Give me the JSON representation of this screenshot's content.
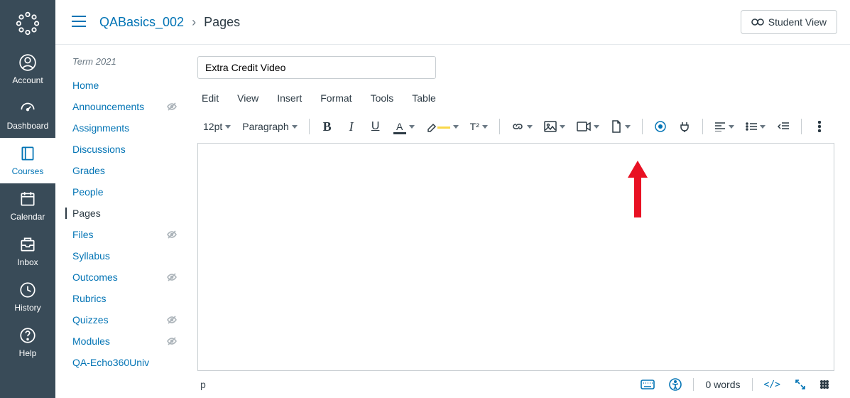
{
  "globalNav": {
    "items": [
      {
        "label": "Account",
        "icon": "user-circle-icon"
      },
      {
        "label": "Dashboard",
        "icon": "dashboard-icon"
      },
      {
        "label": "Courses",
        "icon": "book-icon"
      },
      {
        "label": "Calendar",
        "icon": "calendar-icon"
      },
      {
        "label": "Inbox",
        "icon": "inbox-icon"
      },
      {
        "label": "History",
        "icon": "clock-icon"
      },
      {
        "label": "Help",
        "icon": "help-icon"
      }
    ],
    "active_index": 2
  },
  "breadcrumb": {
    "course": "QABasics_002",
    "current": "Pages"
  },
  "top_buttons": {
    "student_view": "Student View"
  },
  "courseNav": {
    "term": "Term 2021",
    "items": [
      {
        "label": "Home",
        "hidden": false
      },
      {
        "label": "Announcements",
        "hidden": true
      },
      {
        "label": "Assignments",
        "hidden": false
      },
      {
        "label": "Discussions",
        "hidden": false
      },
      {
        "label": "Grades",
        "hidden": false
      },
      {
        "label": "People",
        "hidden": false
      },
      {
        "label": "Pages",
        "hidden": false,
        "active": true
      },
      {
        "label": "Files",
        "hidden": true
      },
      {
        "label": "Syllabus",
        "hidden": false
      },
      {
        "label": "Outcomes",
        "hidden": true
      },
      {
        "label": "Rubrics",
        "hidden": false
      },
      {
        "label": "Quizzes",
        "hidden": true
      },
      {
        "label": "Modules",
        "hidden": true
      },
      {
        "label": "QA-Echo360Univ",
        "hidden": false
      }
    ]
  },
  "editor": {
    "title_value": "Extra Credit Video",
    "menus": [
      "Edit",
      "View",
      "Insert",
      "Format",
      "Tools",
      "Table"
    ],
    "font_size": "12pt",
    "block_format": "Paragraph",
    "superscript_label": "T²",
    "status_path": "p",
    "word_count": "0 words",
    "code_label": "</>"
  }
}
